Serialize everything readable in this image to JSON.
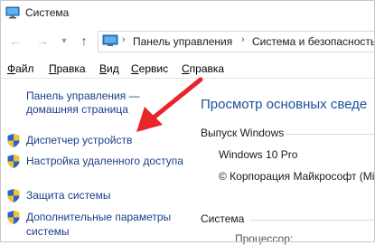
{
  "window": {
    "title": "Система"
  },
  "navigation": {
    "breadcrumbs": [
      "Панель управления",
      "Система и безопасность"
    ]
  },
  "menu": [
    {
      "label": "Файл",
      "accel": "Ф",
      "rest": "айл"
    },
    {
      "label": "Правка",
      "accel": "П",
      "rest": "равка"
    },
    {
      "label": "Вид",
      "accel": "В",
      "rest": "ид"
    },
    {
      "label": "Сервис",
      "accel": "С",
      "rest": "ервис"
    },
    {
      "label": "Справка",
      "accel": "С",
      "rest": "правка"
    }
  ],
  "sidebar": {
    "home_link": "Панель управления — домашняя страница",
    "items": [
      {
        "label": "Диспетчер устройств"
      },
      {
        "label": "Настройка удаленного доступа"
      },
      {
        "label": "Защита системы"
      },
      {
        "label": "Дополнительные параметры системы"
      }
    ]
  },
  "main": {
    "title": "Просмотр основных сведе",
    "windows_section": "Выпуск Windows",
    "edition": "Windows 10 Pro",
    "copyright": "© Корпорация Майкрософт (Micr",
    "system_section": "Система",
    "processor_label": "Процессор:"
  },
  "colors": {
    "link": "#1a3f8a",
    "heading": "#1c4f9e",
    "annotation_arrow": "#e8252a"
  }
}
